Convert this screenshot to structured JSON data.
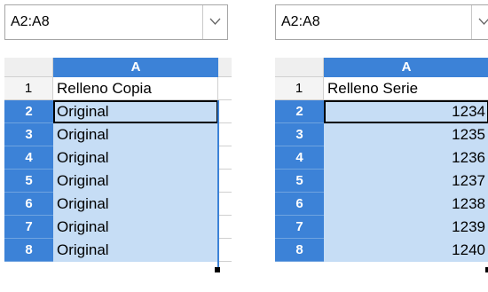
{
  "left_panel": {
    "name_box": "A2:A8",
    "column_header": "A",
    "rows": [
      {
        "num": "1",
        "value": "Relleno Copia"
      },
      {
        "num": "2",
        "value": "Original"
      },
      {
        "num": "3",
        "value": "Original"
      },
      {
        "num": "4",
        "value": "Original"
      },
      {
        "num": "5",
        "value": "Original"
      },
      {
        "num": "6",
        "value": "Original"
      },
      {
        "num": "7",
        "value": "Original"
      },
      {
        "num": "8",
        "value": "Original"
      }
    ]
  },
  "right_panel": {
    "name_box": "A2:A8",
    "column_header": "A",
    "rows": [
      {
        "num": "1",
        "value": "Relleno Serie"
      },
      {
        "num": "2",
        "value": "1234"
      },
      {
        "num": "3",
        "value": "1235"
      },
      {
        "num": "4",
        "value": "1236"
      },
      {
        "num": "5",
        "value": "1237"
      },
      {
        "num": "6",
        "value": "1238"
      },
      {
        "num": "7",
        "value": "1239"
      },
      {
        "num": "8",
        "value": "1240"
      }
    ]
  },
  "colors": {
    "selection_header": "#3c82d7",
    "selection_fill": "#c6ddf5"
  }
}
